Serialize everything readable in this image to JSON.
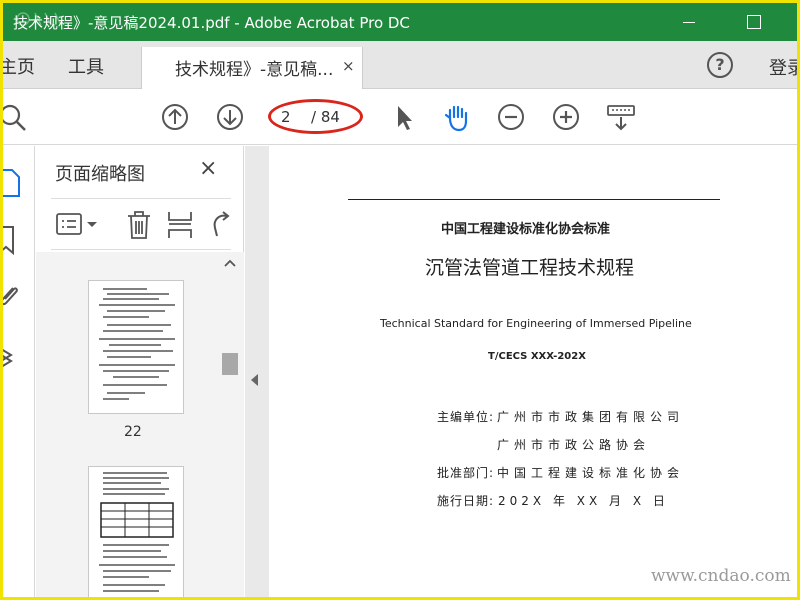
{
  "window": {
    "title": "技术规程》-意见稿2024.01.pdf - Adobe Acrobat Pro DC"
  },
  "menubar": {
    "home": "主页",
    "tools": "工具",
    "doc_tab_label": "技术规程》-意见稿...",
    "doc_tab_close": "×",
    "help": "?",
    "signin": "登录"
  },
  "toolbar": {
    "page_current": "2",
    "page_total": "/ 84",
    "icons": [
      "search-icon",
      "page-up-icon",
      "page-down-icon",
      "select-arrow-icon",
      "hand-icon",
      "zoom-out-icon",
      "zoom-in-icon",
      "keyboard-icon"
    ]
  },
  "thumbnails": {
    "title": "页面缩略图",
    "close": "×",
    "page_numbers": [
      "22"
    ]
  },
  "document": {
    "association": "中国工程建设标准化协会标准",
    "title": "沉管法管道工程技术规程",
    "title_en": "Technical Standard for Engineering of Immersed Pipeline",
    "code": "T/CECS XXX-202X",
    "editor_label": "主编单位:",
    "editor_value_1": "广州市市政集团有限公司",
    "editor_value_2": "广州市市政公路协会",
    "approve_label": "批准部门:",
    "approve_value": "中国工程建设标准化协会",
    "date_label": "施行日期:",
    "date_value": "202X 年 XX 月 X 日"
  },
  "watermark": "www.cndao.com",
  "colors": {
    "titlebar": "#1f8a3e",
    "border": "#f0e300",
    "highlight": "#d9261c",
    "hand_active": "#1473e6"
  }
}
